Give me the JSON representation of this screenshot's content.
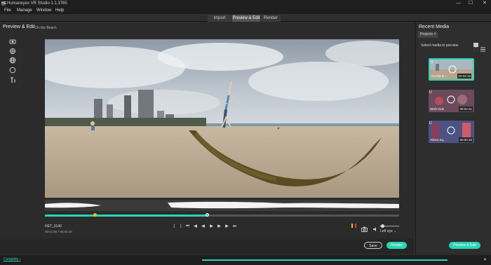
{
  "window": {
    "title": "Humaneyes VR Studio 1.1.3765",
    "app_icon": "HE",
    "minimize": "—",
    "maximize": "☐",
    "close": "✕"
  },
  "menu": [
    "File",
    "Manage",
    "Window",
    "Help"
  ],
  "tabs": [
    {
      "label": "Import",
      "active": false
    },
    {
      "label": "Preview & Edit",
      "active": true
    },
    {
      "label": "Render",
      "active": false
    }
  ],
  "left": {
    "title": "Preview & Edit",
    "subtitle": "- On the Beach",
    "tools": [
      "stabilize-icon",
      "reticle-icon",
      "globe-icon",
      "circle-icon",
      "text-icon"
    ]
  },
  "player": {
    "clip_name": "HET_0140",
    "timecode": "00:01:06 / 00:02:10",
    "progress": 0.46,
    "in_marker": 0.14,
    "controls": [
      "⌊",
      "⌋",
      "⏮",
      "◀",
      "◀",
      "▶",
      "▶",
      "▶",
      "⏭"
    ],
    "eye_label": "Left eye",
    "eye_caret": "⌄",
    "camera_icon": "⌑",
    "volume_icon": "🔈",
    "colors": {
      "accent": "#2bd4b4",
      "marker_yellow": "#e8c020",
      "marker_red": "#e04040"
    }
  },
  "footer": {
    "save": "Save",
    "render": "Render"
  },
  "right": {
    "title": "Recent Media",
    "projects_tab": "Projects",
    "projects_close": "×",
    "hint": "Select media to preview.",
    "media": [
      {
        "name": "On the B...",
        "duration": "00:02:10",
        "selected": true
      },
      {
        "name": "Wish Kids",
        "duration": "00:02:21",
        "selected": false
      },
      {
        "name": "Times Sq...",
        "duration": "00:00:46",
        "selected": false
      }
    ],
    "preview_button": "Preview & Edit"
  },
  "status": {
    "link": "Complete",
    "arrow": "›",
    "progress": 1.0,
    "close": "✕"
  }
}
